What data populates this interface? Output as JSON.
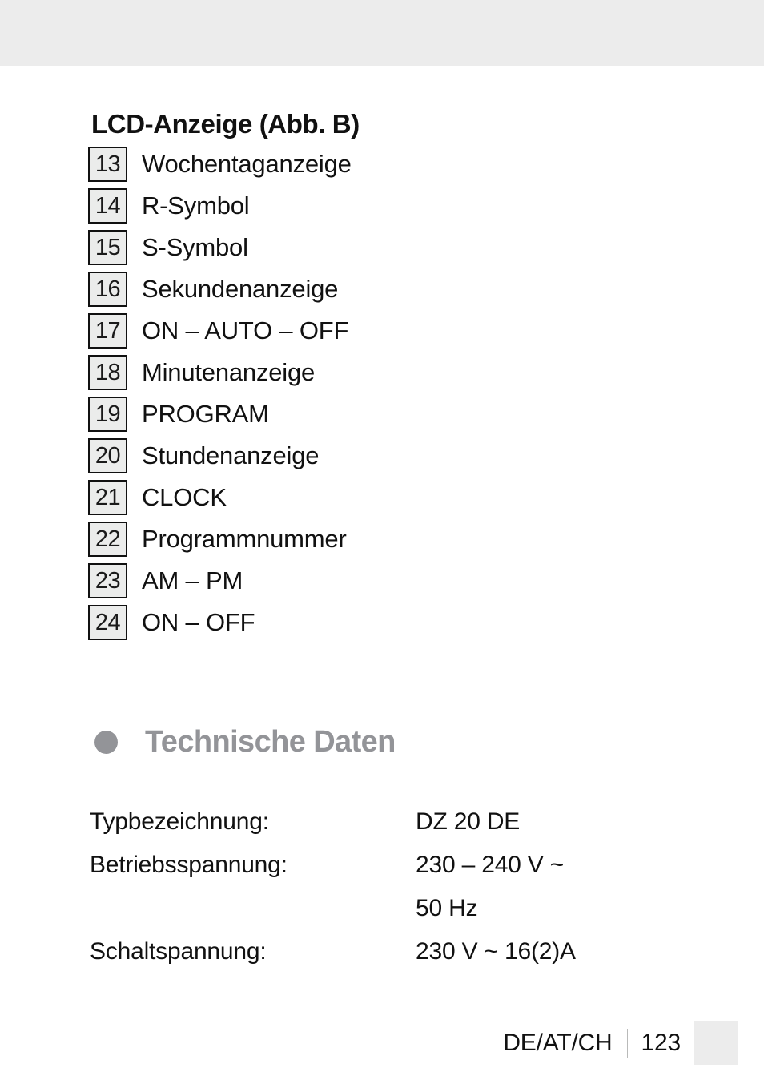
{
  "page": {
    "footer": {
      "locale": "DE/AT/CH",
      "page_number": "123"
    },
    "colors": {
      "band_gray": "#ececec",
      "heading_gray": "#939498",
      "box_fill": "#ebeceb",
      "box_border": "#111111",
      "text": "#111111"
    }
  },
  "legend": {
    "title": "LCD-Anzeige (Abb. B)",
    "items": [
      {
        "number": "13",
        "label": "Wochentaganzeige"
      },
      {
        "number": "14",
        "label": "R-Symbol"
      },
      {
        "number": "15",
        "label": "S-Symbol"
      },
      {
        "number": "16",
        "label": "Sekundenanzeige"
      },
      {
        "number": "17",
        "label": "ON – AUTO – OFF"
      },
      {
        "number": "18",
        "label": "Minutenanzeige"
      },
      {
        "number": "19",
        "label": "PROGRAM"
      },
      {
        "number": "20",
        "label": "Stundenanzeige"
      },
      {
        "number": "21",
        "label": "CLOCK"
      },
      {
        "number": "22",
        "label": "Programmnummer"
      },
      {
        "number": "23",
        "label": "AM – PM"
      },
      {
        "number": "24",
        "label": "ON – OFF"
      }
    ]
  },
  "technical_data": {
    "heading": "Technische Daten",
    "bullet_icon": "filled-circle-icon",
    "specs": [
      {
        "key": "Typbezeichnung:",
        "value": "DZ 20 DE"
      },
      {
        "key": "Betriebsspannung:",
        "value": "230 – 240 V ~"
      },
      {
        "key": "",
        "value": "50 Hz"
      },
      {
        "key": "Schaltspannung:",
        "value": "230 V ~ 16(2)A"
      }
    ]
  }
}
